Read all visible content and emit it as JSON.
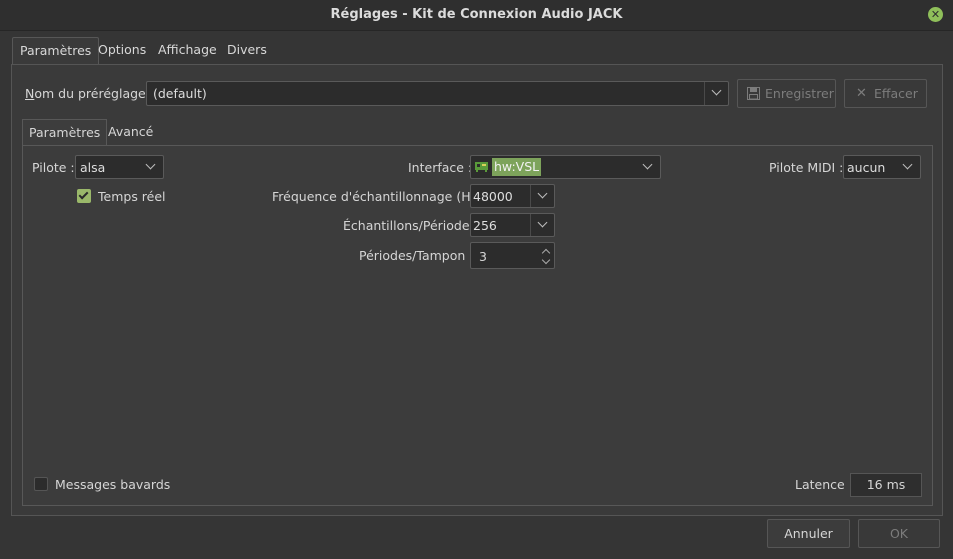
{
  "window": {
    "title": "Réglages - Kit de Connexion Audio JACK",
    "close_glyph": "✕"
  },
  "tabs": [
    "Paramètres",
    "Options",
    "Affichage",
    "Divers"
  ],
  "preset": {
    "label": "Nom du préréglage :",
    "value": "(default)",
    "save_button": "Enregistrer",
    "delete_button": "Effacer"
  },
  "inner_tabs": [
    "Paramètres",
    "Avancé"
  ],
  "params": {
    "driver_label": "Pilote :",
    "driver_value": "alsa",
    "realtime_label": "Temps réel",
    "realtime_checked": true,
    "interface_label": "Interface :",
    "interface_value": "hw:VSL",
    "sample_rate_label": "Fréquence d'échantillonnage (Hz) :",
    "sample_rate_value": "48000",
    "frames_label": "Échantillons/Période :",
    "frames_value": "256",
    "periods_label": "Périodes/Tampon :",
    "periods_value": "3",
    "midi_label": "Pilote MIDI :",
    "midi_value": "aucun",
    "verbose_label": "Messages bavards",
    "verbose_checked": false,
    "latency_label": "Latence :",
    "latency_value": "16 ms"
  },
  "footer": {
    "cancel": "Annuler",
    "ok": "OK"
  },
  "colors": {
    "accent": "#7da35b",
    "checkbox_on": "#9ab86a",
    "close": "#8fbf5a"
  }
}
